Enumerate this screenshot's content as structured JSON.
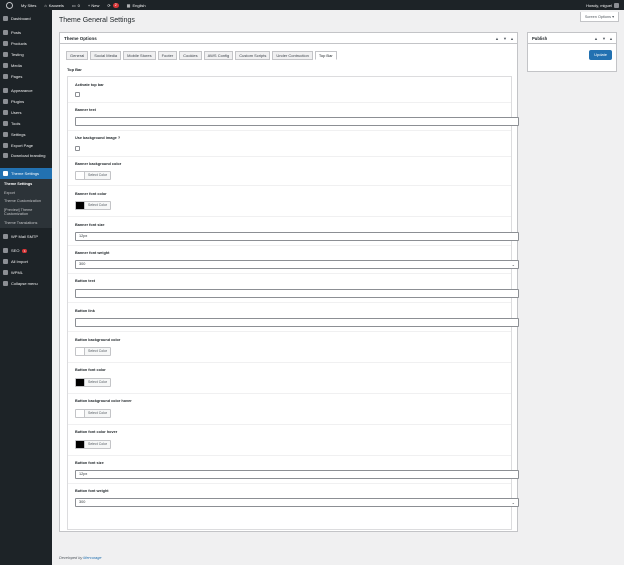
{
  "adminbar": {
    "site": "My Sites",
    "site_name": "Kaowels",
    "comments": "0",
    "new": "+ New",
    "updates": "2",
    "language": "English",
    "howdy": "Howdy, miguel"
  },
  "sidebar": {
    "dashboard": "Dashboard",
    "posts": "Posts",
    "products": "Products",
    "testing": "Testing",
    "media": "Media",
    "pages": "Pages",
    "appearance": "Appearance",
    "plugins": "Plugins",
    "users": "Users",
    "tools": "Tools",
    "settings": "Settings",
    "export_page": "Export Page",
    "download_branding": "Download branding",
    "theme_settings": "Theme Settings",
    "sub": {
      "theme_settings": "Theme Settings",
      "export": "Export",
      "theme_customization": "Theme Customization",
      "preview_customization": "[Preview] Theme Customization",
      "theme_translations": "Theme Translations"
    },
    "wp_mail_smtp": "WP Mail SMTP",
    "seo": "SEO",
    "seo_badge": "1",
    "all_import": "All Import",
    "wpml": "WPML",
    "collapse": "Collapse menu"
  },
  "screen_options": "Screen Options ▾",
  "page_title": "Theme General Settings",
  "options_box": {
    "title": "Theme Options",
    "handles": [
      "▲",
      "▼",
      "▴"
    ],
    "tabs": [
      "General",
      "Social Media",
      "Mobile Stores",
      "Footer",
      "Cookies",
      "AWS Config",
      "Custom Scripts",
      "Under Contruction",
      "Top Bar"
    ],
    "section": "Top Bar",
    "fields": {
      "activate": "Activate top bar",
      "banner_text": "Banner text",
      "use_bg_image": "Use background image ?",
      "banner_bg_color": "Banner background color",
      "banner_font_color": "Banner font color",
      "banner_font_size": "Banner font size",
      "banner_font_size_value": "12px",
      "banner_font_weight": "Banner font weight",
      "banner_font_weight_value": "300",
      "button_text": "Button text",
      "button_link": "Button link",
      "button_bg_color": "Button background color",
      "button_font_color": "Button font color",
      "button_bg_hover": "Button background color hover",
      "button_font_hover": "Button font color hover",
      "button_font_size": "Button font size",
      "button_font_size_value": "12px",
      "button_font_weight": "Button font weight",
      "button_font_weight_value": "300",
      "select_color": "Select Color"
    }
  },
  "publish": {
    "title": "Publish",
    "update": "Update"
  },
  "footer": {
    "prefix": "Developed by ",
    "link": "Mercurage"
  },
  "colors": {
    "admin_dark": "#1d2327",
    "accent": "#2271b1"
  }
}
